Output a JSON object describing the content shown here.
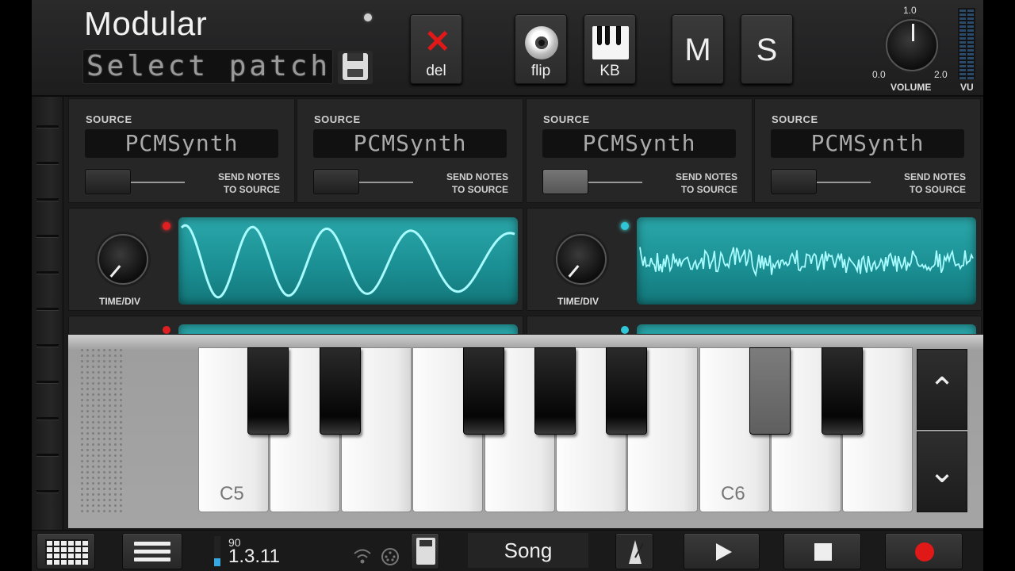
{
  "app": {
    "title": "Modular",
    "patch_display": "Select patch"
  },
  "header_buttons": {
    "del": "del",
    "flip": "flip",
    "kb": "KB",
    "m": "M",
    "s": "S"
  },
  "volume": {
    "label": "VOLUME",
    "min": "0.0",
    "mid": "1.0",
    "max": "2.0",
    "vu_label": "VU"
  },
  "sources": [
    {
      "label": "SOURCE",
      "value": "PCMSynth",
      "send_line1": "SEND NOTES",
      "send_line2": "TO SOURCE",
      "toggle_on": false
    },
    {
      "label": "SOURCE",
      "value": "PCMSynth",
      "send_line1": "SEND NOTES",
      "send_line2": "TO SOURCE",
      "toggle_on": false
    },
    {
      "label": "SOURCE",
      "value": "PCMSynth",
      "send_line1": "SEND NOTES",
      "send_line2": "TO SOURCE",
      "toggle_on": true
    },
    {
      "label": "SOURCE",
      "value": "PCMSynth",
      "send_line1": "SEND NOTES",
      "send_line2": "TO SOURCE",
      "toggle_on": false
    }
  ],
  "scopes": [
    {
      "knob_label": "TIME/DIV",
      "led_color": "#e02020",
      "waveform": "sine"
    },
    {
      "knob_label": "TIME/DIV",
      "led_color": "#2fc7d8",
      "waveform": "noise"
    }
  ],
  "keyboard": {
    "note_c5": "C5",
    "note_c6": "C6",
    "up_arrow": "⌃",
    "down_arrow": "⌄"
  },
  "transport": {
    "tempo": "90",
    "position": "1.3.11",
    "song_label": "Song"
  },
  "colors": {
    "scope_screen": "#1f9a9e",
    "scope_trace": "#a8fbff",
    "record": "#e01818"
  },
  "icons": [
    "delete-icon",
    "jack-icon",
    "keyboard-icon",
    "save-icon",
    "grid-icon",
    "menu-icon",
    "wifi-icon",
    "metronome-icon",
    "play-icon",
    "stop-icon",
    "record-icon"
  ]
}
